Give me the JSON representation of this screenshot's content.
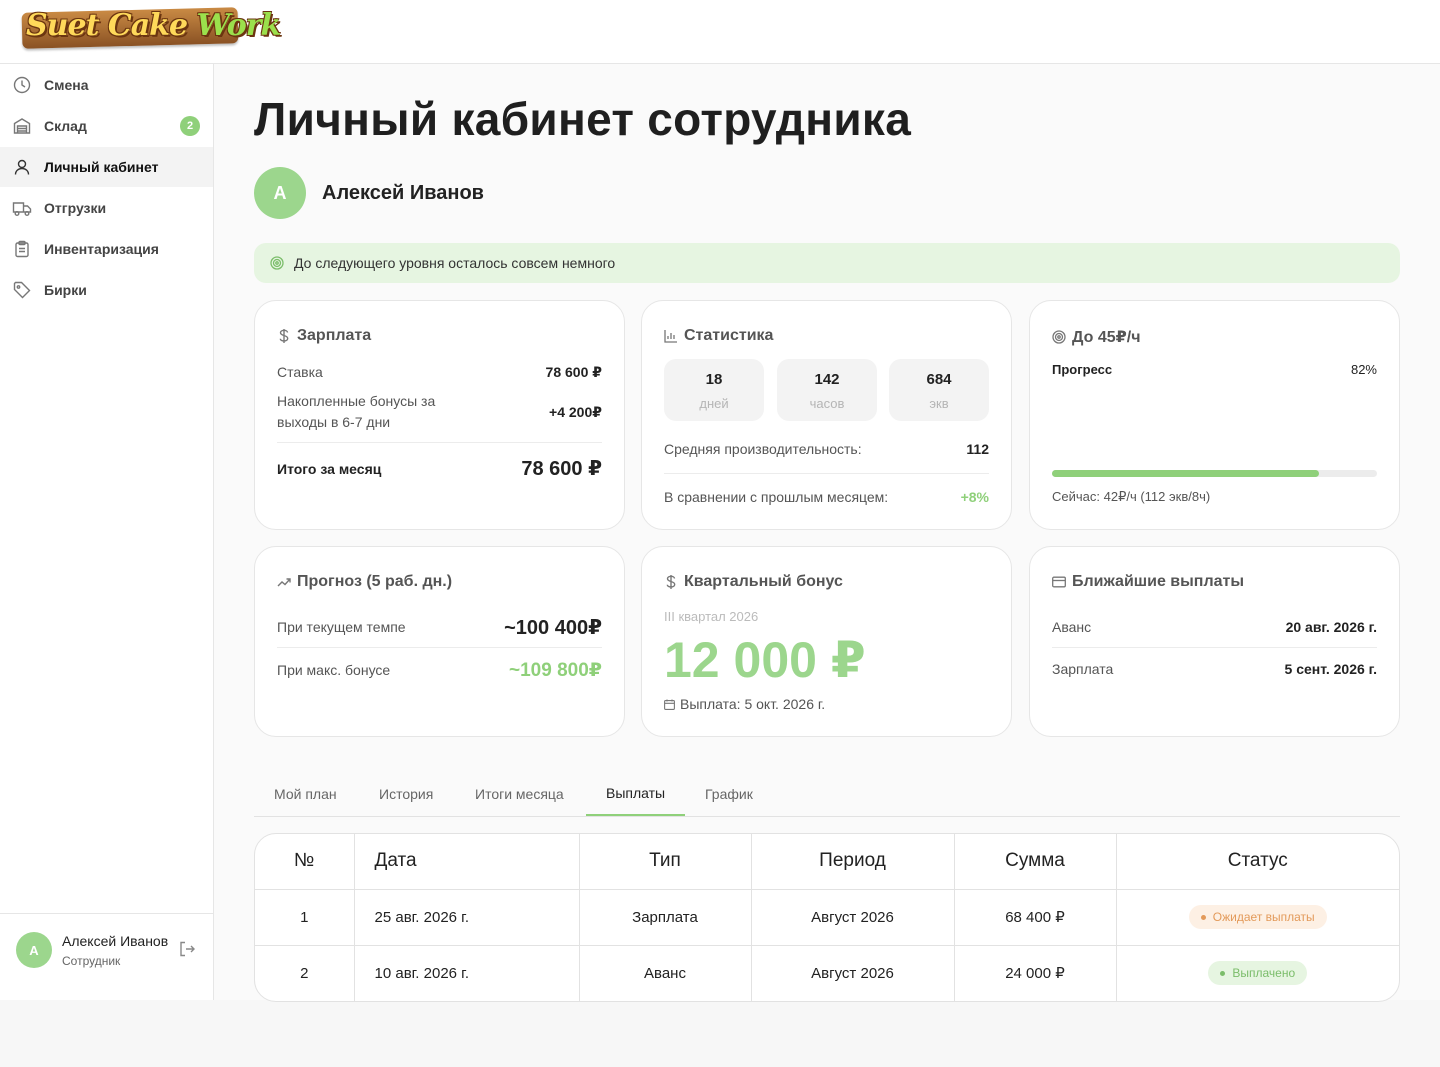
{
  "brand": {
    "logo_main": "Suet Cake ",
    "logo_accent": "Work"
  },
  "sidebar": {
    "items": [
      {
        "label": "Смена",
        "icon": "clock-icon"
      },
      {
        "label": "Склад",
        "icon": "warehouse-icon",
        "badge": "2"
      },
      {
        "label": "Личный кабинет",
        "icon": "user-icon"
      },
      {
        "label": "Отгрузки",
        "icon": "truck-icon"
      },
      {
        "label": "Инвентаризация",
        "icon": "clipboard-icon"
      },
      {
        "label": "Бирки",
        "icon": "tag-icon"
      }
    ],
    "active_index": 2,
    "user": {
      "initial": "А",
      "name": "Алексей Иванов",
      "role": "Сотрудник"
    }
  },
  "page": {
    "title": "Личный кабинет сотрудника",
    "user_initial": "А",
    "user_name": "Алексей Иванов",
    "banner": "До следующего уровня осталось совсем немного"
  },
  "salary": {
    "title": "Зарплата",
    "rate_label": "Ставка",
    "rate_value": "78 600 ₽",
    "bonus_label_1": "Накопленные бонусы за",
    "bonus_label_2": "выходы в 6-7 дни",
    "bonus_value": "+4 200₽",
    "total_label": "Итого за месяц",
    "total_value": "78 600 ₽"
  },
  "stats": {
    "title": "Статистика",
    "boxes": [
      {
        "num": "18",
        "unit": "дней"
      },
      {
        "num": "142",
        "unit": "часов"
      },
      {
        "num": "684",
        "unit": "экв"
      }
    ],
    "avg_label": "Средняя производительность:",
    "avg_value": "112",
    "compare_label": "В сравнении с прошлым месяцем:",
    "compare_value": "+8%"
  },
  "goal": {
    "title": "До 45₽/ч",
    "progress_label": "Прогресс",
    "progress_text": "82%",
    "progress_fraction": 0.82,
    "current": "Сейчас: 42₽/ч (112 экв/8ч)"
  },
  "forecast": {
    "title": "Прогноз (5 раб. дн.)",
    "current_label": "При текущем темпе",
    "current_value": "~100 400₽",
    "max_label": "При макс. бонусе",
    "max_value": "~109 800₽"
  },
  "quarter": {
    "title": "Квартальный бонус",
    "period": "III квартал 2026",
    "amount": "12 000 ₽",
    "payout": "Выплата: 5 окт. 2026 г."
  },
  "payouts": {
    "title": "Ближайшие выплаты",
    "advance_label": "Аванс",
    "advance_date": "20 авг. 2026 г.",
    "salary_label": "Зарплата",
    "salary_date": "5 сент. 2026 г."
  },
  "tabs": [
    "Мой план",
    "История",
    "Итоги месяца",
    "Выплаты",
    "График"
  ],
  "active_tab": 3,
  "table": {
    "headers": [
      "№",
      "Дата",
      "Тип",
      "Период",
      "Сумма",
      "Статус"
    ],
    "rows": [
      {
        "num": "1",
        "date": "25 авг. 2026 г.",
        "type": "Зарплата",
        "period": "Август 2026",
        "sum": "68 400 ₽",
        "status": "Ожидает выплаты"
      },
      {
        "num": "2",
        "date": "10 авг. 2026 г.",
        "type": "Аванс",
        "period": "Август 2026",
        "sum": "24 000 ₽",
        "status": "Выплачено"
      }
    ]
  },
  "colors": {
    "accent": "#8fd07a",
    "accent_soft": "#e6f5e1",
    "pending": "#e39a5a",
    "pending_soft": "#fdf0e4"
  }
}
